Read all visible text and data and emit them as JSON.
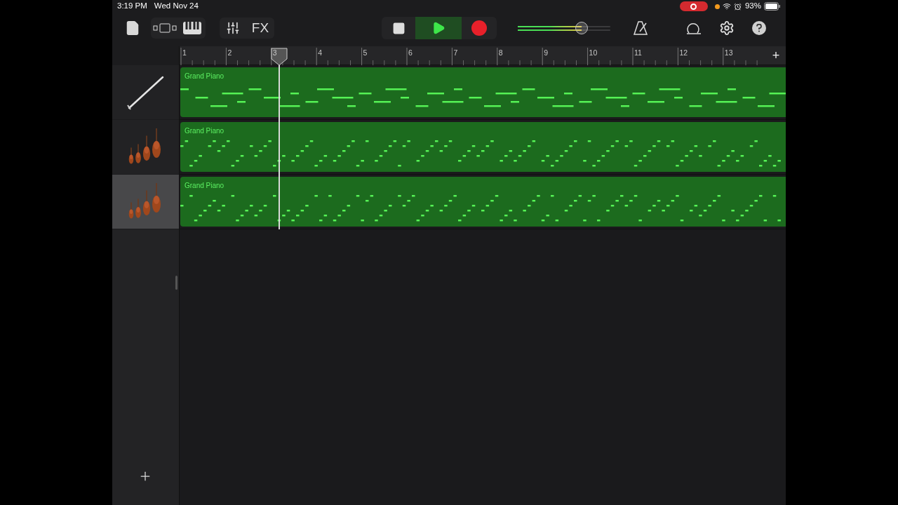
{
  "status_bar": {
    "time": "3:19 PM",
    "date": "Wed Nov 24",
    "recording": true,
    "battery": "93%"
  },
  "toolbar": {
    "fx_label": "FX",
    "playing": true,
    "master_volume": {
      "level": 0.69
    }
  },
  "ruler": {
    "bars": [
      "1",
      "2",
      "3",
      "4",
      "5",
      "6",
      "7",
      "8",
      "9",
      "10",
      "11",
      "12",
      "13"
    ],
    "add": "+"
  },
  "tracks": [
    {
      "kind": "clarinet",
      "selected": false,
      "region": {
        "label": "Grand Piano"
      }
    },
    {
      "kind": "strings",
      "selected": false,
      "region": {
        "label": "Grand Piano"
      }
    },
    {
      "kind": "strings",
      "selected": true,
      "region": {
        "label": "Grand Piano"
      }
    }
  ]
}
